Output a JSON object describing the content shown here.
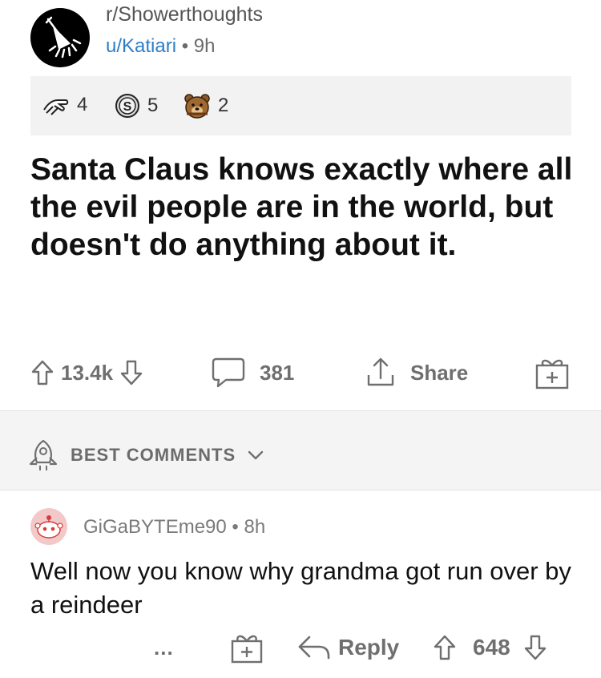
{
  "post": {
    "subreddit": "r/Showerthoughts",
    "author": "u/Katiari",
    "age": "9h",
    "awards": [
      {
        "icon": "helping-hand-award-icon",
        "count": "4"
      },
      {
        "icon": "silver-award-icon",
        "count": "5"
      },
      {
        "icon": "wholesome-bear-award-icon",
        "count": "2"
      }
    ],
    "title": "Santa Claus knows exactly where all the evil people are in the world, but doesn't do anything about it.",
    "upvotes": "13.4k",
    "comments": "381",
    "share_label": "Share"
  },
  "comments_section": {
    "sort_label": "BEST COMMENTS"
  },
  "comment": {
    "author": "GiGaBYTEme90",
    "age": "8h",
    "body": "Well now you know why grandma got run over by a reindeer",
    "more": "...",
    "reply_label": "Reply",
    "votes": "648"
  },
  "colors": {
    "link_blue": "#2e7ec7",
    "muted_gray": "#6f6f6f",
    "band_gray": "#f4f4f4"
  }
}
